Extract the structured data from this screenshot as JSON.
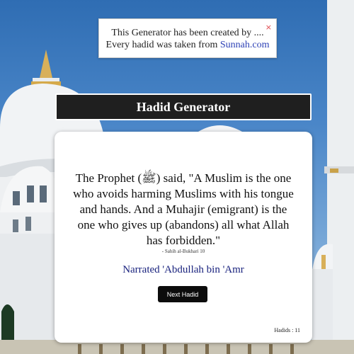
{
  "notice": {
    "line1": "This Generator has been created by ....",
    "line2_prefix": "Every hadid was taken from ",
    "link_text": "Sunnah.com",
    "close_glyph": "×"
  },
  "header": {
    "title": "Hadid Generator"
  },
  "hadith": {
    "text": "The Prophet (ﷺ) said, \"A Muslim is the one who avoids harming Muslims with his tongue and hands. And a Muhajir (emigrant) is the one who gives up (abandons) all what Allah has forbidden.\"",
    "source": "- Sahih al-Bukhari 10",
    "narrator": "Narrated 'Abdullah bin 'Amr"
  },
  "controls": {
    "next_label": "Next Hadid"
  },
  "footer": {
    "count_label": "Hadids : ",
    "count_value": "11"
  },
  "colors": {
    "link": "#2b3fb5",
    "narrator": "#1a237e",
    "close": "#e0484e",
    "header_bg": "#1f1f1f"
  }
}
